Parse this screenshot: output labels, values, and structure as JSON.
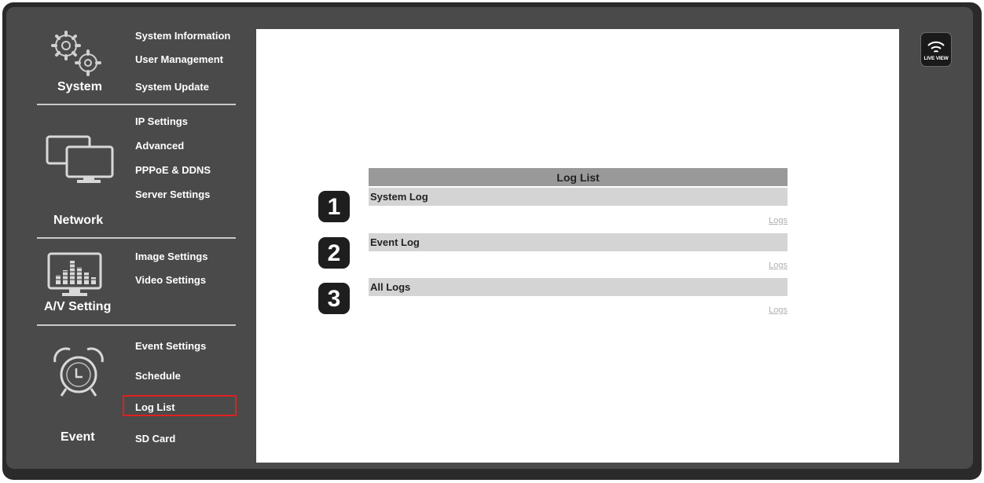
{
  "sidebar": {
    "system": {
      "title": "System",
      "icon": "gears-icon",
      "items": [
        "System Information",
        "User Management",
        "System Update"
      ]
    },
    "network": {
      "title": "Network",
      "icon": "monitors-icon",
      "items": [
        "IP Settings",
        "Advanced",
        "PPPoE & DDNS",
        "Server Settings"
      ]
    },
    "av": {
      "title": "A/V Setting",
      "icon": "av-monitor-icon",
      "items": [
        "Image Settings",
        "Video Settings"
      ]
    },
    "event": {
      "title": "Event",
      "icon": "alarm-clock-icon",
      "items": [
        "Event Settings",
        "Schedule",
        "Log List",
        "SD Card"
      ],
      "active": "Log List"
    }
  },
  "main": {
    "header": "Log List",
    "rows": [
      {
        "number": "1",
        "label": "System Log",
        "link": "Logs"
      },
      {
        "number": "2",
        "label": "Event Log",
        "link": "Logs"
      },
      {
        "number": "3",
        "label": "All Logs",
        "link": "Logs"
      }
    ]
  },
  "live_view": {
    "label": "LIVE VIEW",
    "icon": "wifi-icon"
  },
  "colors": {
    "panel": "#4a4a4a",
    "frame": "#2a2a2a",
    "active_border": "#e02020",
    "header_bar": "#999999",
    "row_bar": "#d4d4d4"
  }
}
